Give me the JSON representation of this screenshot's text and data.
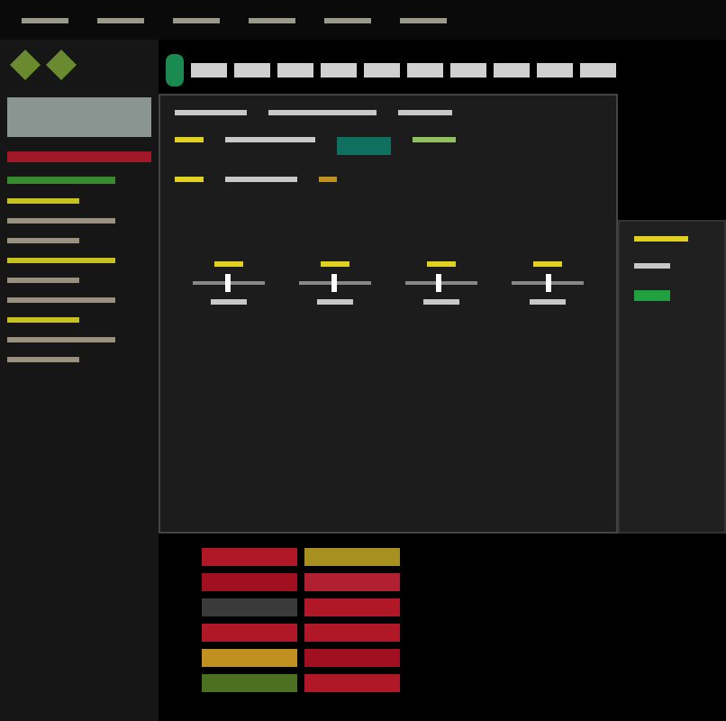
{
  "toolbar": {
    "buttons": [
      {
        "selected": true
      },
      {
        "selected": false
      },
      {
        "selected": false
      },
      {
        "selected": false
      },
      {
        "selected": false
      },
      {
        "selected": false
      },
      {
        "selected": false
      },
      {
        "selected": false
      },
      {
        "selected": false
      },
      {
        "selected": false
      },
      {
        "selected": false
      }
    ]
  },
  "mixer": {
    "channels": [
      {
        "level": 0.5
      },
      {
        "level": 0.48
      },
      {
        "level": 0.45
      },
      {
        "level": 0.5
      }
    ]
  },
  "clip_grid": {
    "rows": [
      {
        "clips": [
          {
            "color": "#b01828"
          },
          {
            "color": "#a89020"
          }
        ]
      },
      {
        "clips": [
          {
            "color": "#a01020"
          },
          {
            "color": "#b02030"
          }
        ]
      },
      {
        "clips": [
          {
            "color": "#3a3a3a"
          },
          {
            "color": "#b01828"
          }
        ]
      },
      {
        "clips": [
          {
            "color": "#b01828"
          },
          {
            "color": "#b01828"
          }
        ]
      },
      {
        "clips": [
          {
            "color": "#c09020"
          },
          {
            "color": "#a01020"
          }
        ]
      },
      {
        "clips": [
          {
            "color": "#4a7020"
          },
          {
            "color": "#b01828"
          }
        ]
      }
    ]
  }
}
